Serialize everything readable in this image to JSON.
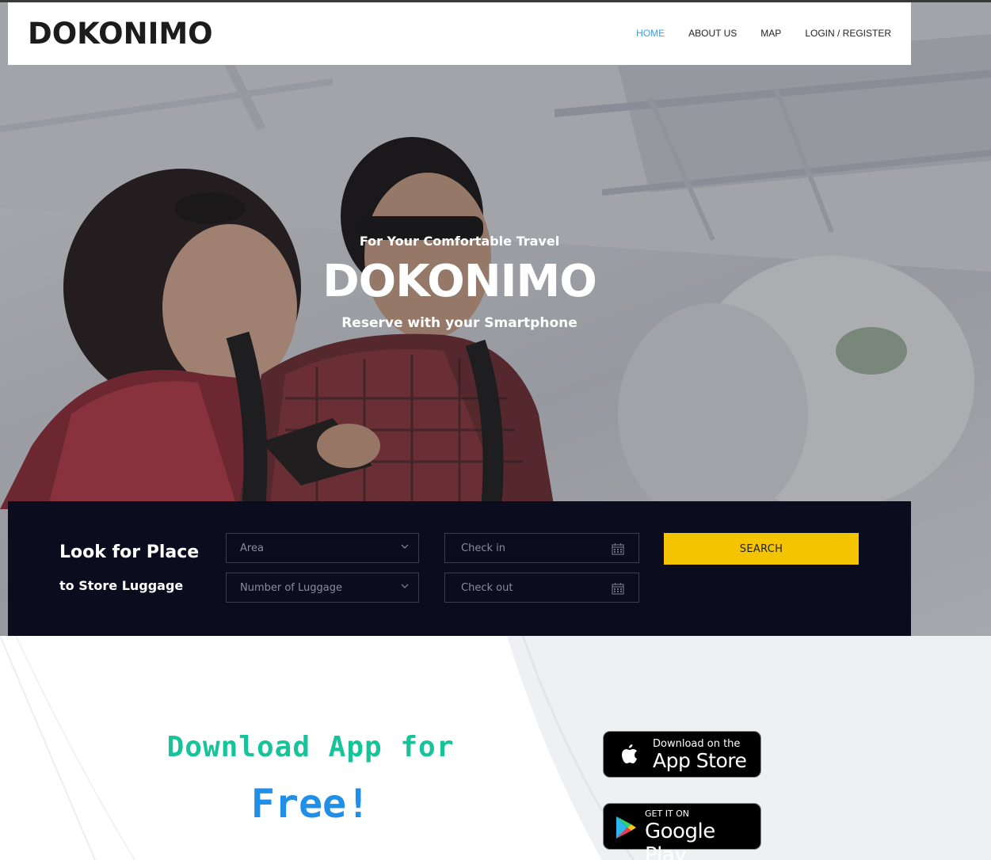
{
  "brand": "DOKONIMO",
  "nav": [
    {
      "label": "HOME",
      "active": true
    },
    {
      "label": "ABOUT US",
      "active": false
    },
    {
      "label": "MAP",
      "active": false
    },
    {
      "label": "LOGIN / REGISTER",
      "active": false
    }
  ],
  "hero": {
    "tagline": "For Your Comfortable Travel",
    "title": "DOKONIMO",
    "subtitle": "Reserve with your Smartphone"
  },
  "search": {
    "title_line1": "Look for Place",
    "title_line2": "to Store Luggage",
    "area_placeholder": "Area",
    "luggage_placeholder": "Number of Luggage",
    "checkin_placeholder": "Check in",
    "checkout_placeholder": "Check out",
    "button_label": "SEARCH"
  },
  "download": {
    "line1": "Download App for",
    "line2": "Free!",
    "appstore_small": "Download on the",
    "appstore_big": "App Store",
    "googleplay_small": "GET IT ON",
    "googleplay_big": "Google Play"
  },
  "colors": {
    "accent_blue": "#3aa0e8",
    "panel_navy": "#0b0d1f",
    "search_yellow": "#f5c400",
    "download_green": "#17c49a",
    "free_blue": "#1f8fe8"
  },
  "icons": [
    "chevron-down-icon",
    "calendar-icon",
    "apple-icon",
    "google-play-icon"
  ]
}
